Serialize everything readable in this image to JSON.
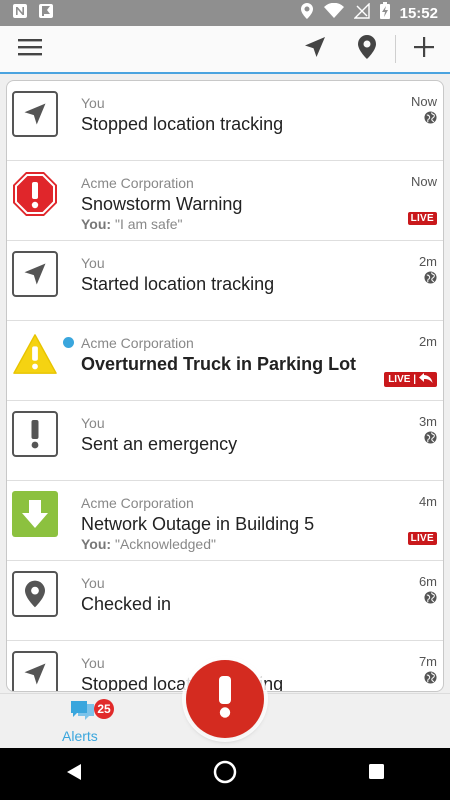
{
  "status_bar": {
    "time": "15:52",
    "icons": [
      "n-notification-icon",
      "flag-notification-icon",
      "location-icon",
      "wifi-icon",
      "signal-icon",
      "battery-charging-icon"
    ]
  },
  "app_bar": {
    "icons": [
      "menu-icon",
      "navigation-arrow-icon",
      "map-pin-icon",
      "plus-icon"
    ],
    "accent_color": "#4aa3df"
  },
  "alerts": [
    {
      "sender": "You",
      "title": "Stopped location tracking",
      "time": "Now",
      "icon": "navigation-arrow-icon"
    },
    {
      "sender": "Acme Corporation",
      "title": "Snowstorm Warning",
      "response_label": "You:",
      "response": "\"I am safe\"",
      "time": "Now",
      "live": "LIVE",
      "icon": "stop-octagon-icon"
    },
    {
      "sender": "You",
      "title": "Started location tracking",
      "time": "2m",
      "icon": "navigation-arrow-icon"
    },
    {
      "sender": "Acme Corporation",
      "title": "Overturned Truck in Parking Lot",
      "time": "2m",
      "live": "LIVE |",
      "icon": "warning-triangle-icon",
      "unread": true
    },
    {
      "sender": "You",
      "title": "Sent an emergency",
      "time": "3m",
      "icon": "exclamation-icon"
    },
    {
      "sender": "Acme Corporation",
      "title": "Network Outage in Building 5",
      "response_label": "You:",
      "response": "\"Acknowledged\"",
      "time": "4m",
      "live": "LIVE",
      "icon": "down-arrow-icon"
    },
    {
      "sender": "You",
      "title": "Checked in",
      "time": "6m",
      "icon": "map-pin-icon"
    },
    {
      "sender": "You",
      "title": "Stopped location tracking",
      "time": "7m",
      "icon": "navigation-arrow-icon"
    }
  ],
  "bottom_nav": {
    "alerts_label": "Alerts",
    "alerts_badge": "25",
    "fab_icon": "exclamation-icon"
  },
  "colors": {
    "live_red": "#c9181b",
    "stop_red": "#e0262b",
    "warning_yellow": "#f5d312",
    "outage_green": "#8cc13f",
    "unread_blue": "#3aa6dd",
    "fab_red": "#d42b20"
  }
}
